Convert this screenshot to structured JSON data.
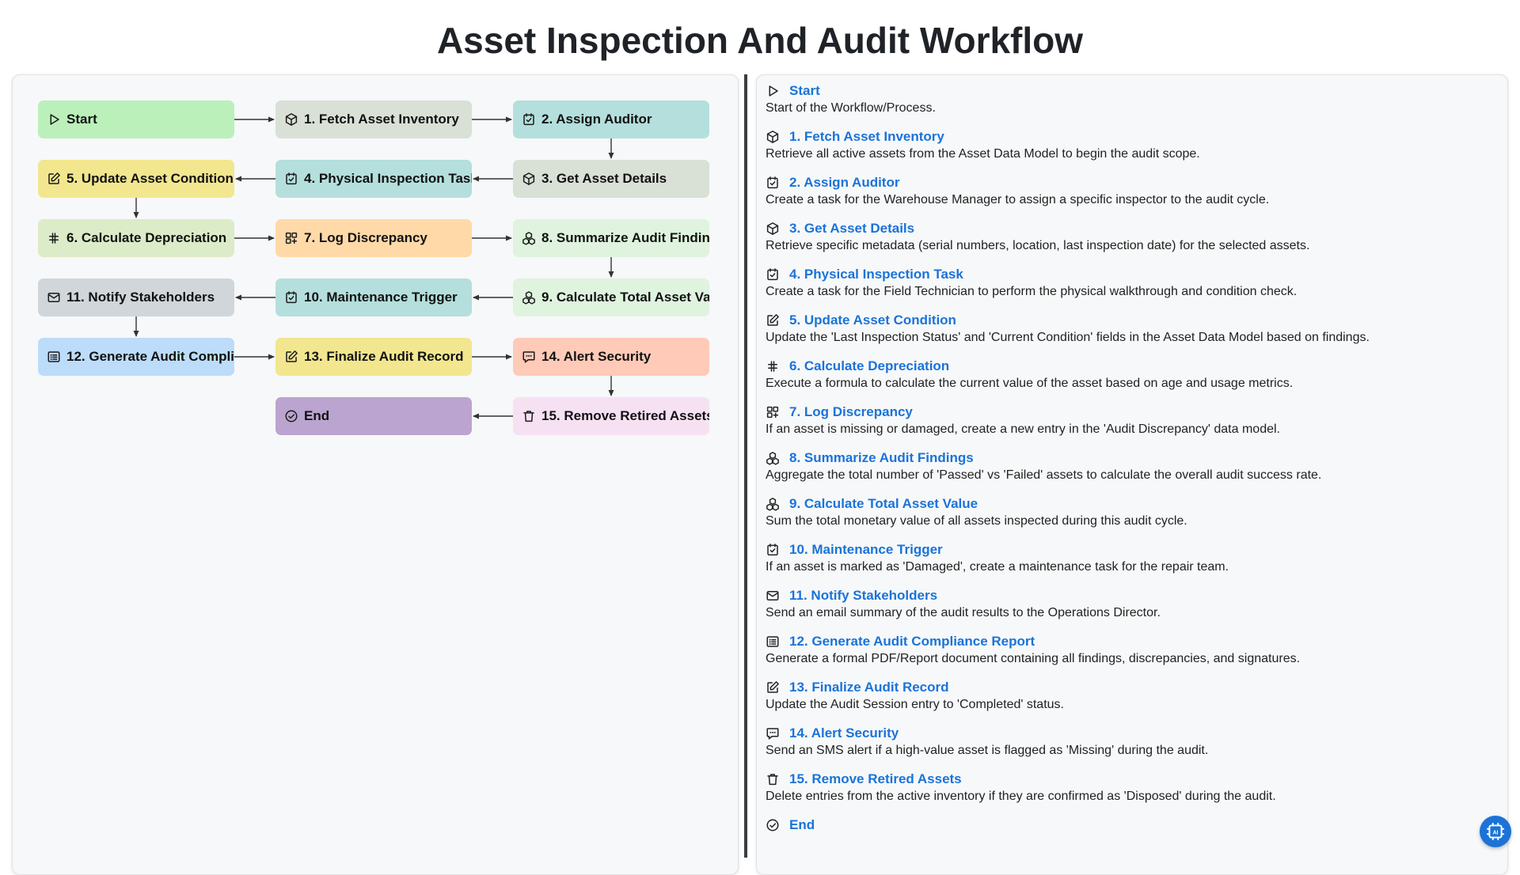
{
  "title": "Asset Inspection And Audit Workflow",
  "colors": {
    "link": "#1a73d9",
    "green": "#bbf0bb",
    "gray": "#d9e0d6",
    "teal": "#b4dfdc",
    "yellow": "#f2e68f",
    "lightgreen": "#dcebc8",
    "orange": "#ffd9a8",
    "mint": "#dff3df",
    "slate": "#d0d6da",
    "blue": "#bcdcfa",
    "salmon": "#ffcab7",
    "pink": "#f6e1f3",
    "purple": "#bba4cf"
  },
  "nodes": [
    {
      "label": "Start",
      "icon": "play-icon",
      "color": "green"
    },
    {
      "label": "1. Fetch Asset Inventory",
      "icon": "cube-icon",
      "color": "gray"
    },
    {
      "label": "2. Assign Auditor",
      "icon": "task-check-icon",
      "color": "teal"
    },
    {
      "label": "3. Get Asset Details",
      "icon": "cube-icon",
      "color": "gray"
    },
    {
      "label": "4. Physical Inspection Task",
      "icon": "task-check-icon",
      "color": "teal"
    },
    {
      "label": "5. Update Asset Condition",
      "icon": "edit-icon",
      "color": "yellow"
    },
    {
      "label": "6. Calculate Depreciation",
      "icon": "hash-icon",
      "color": "lightgreen"
    },
    {
      "label": "7. Log Discrepancy",
      "icon": "grid-plus-icon",
      "color": "orange"
    },
    {
      "label": "8. Summarize Audit Findings",
      "icon": "cubes-icon",
      "color": "mint"
    },
    {
      "label": "9. Calculate Total Asset Value",
      "icon": "cubes-icon",
      "color": "mint"
    },
    {
      "label": "10. Maintenance Trigger",
      "icon": "task-check-icon",
      "color": "teal"
    },
    {
      "label": "11. Notify Stakeholders",
      "icon": "mail-icon",
      "color": "slate"
    },
    {
      "label": "12. Generate Audit Compliance Report",
      "icon": "report-icon",
      "color": "blue"
    },
    {
      "label": "13. Finalize Audit Record",
      "icon": "edit-icon",
      "color": "yellow"
    },
    {
      "label": "14. Alert Security",
      "icon": "message-icon",
      "color": "salmon"
    },
    {
      "label": "15. Remove Retired Assets",
      "icon": "trash-icon",
      "color": "pink"
    },
    {
      "label": "End",
      "icon": "check-circle-icon",
      "color": "purple"
    }
  ],
  "descriptions": [
    "Start of the Workflow/Process.",
    "Retrieve all active assets from the Asset Data Model to begin the audit scope.",
    "Create a task for the Warehouse Manager to assign a specific inspector to the audit cycle.",
    "Retrieve specific metadata (serial numbers, location, last inspection date) for the selected assets.",
    "Create a task for the Field Technician to perform the physical walkthrough and condition check.",
    "Update the 'Last Inspection Status' and 'Current Condition' fields in the Asset Data Model based on findings.",
    "Execute a formula to calculate the current value of the asset based on age and usage metrics.",
    "If an asset is missing or damaged, create a new entry in the 'Audit Discrepancy' data model.",
    "Aggregate the total number of 'Passed' vs 'Failed' assets to calculate the overall audit success rate.",
    "Sum the total monetary value of all assets inspected during this audit cycle.",
    "If an asset is marked as 'Damaged', create a maintenance task for the repair team.",
    "Send an email summary of the audit results to the Operations Director.",
    "Generate a formal PDF/Report document containing all findings, discrepancies, and signatures.",
    "Update the Audit Session entry to 'Completed' status.",
    "Send an SMS alert if a high-value asset is flagged as 'Missing' during the audit.",
    "Delete entries from the active inventory if they are confirmed as 'Disposed' during the audit.",
    ""
  ],
  "fab_icon": "ai-chip-icon"
}
